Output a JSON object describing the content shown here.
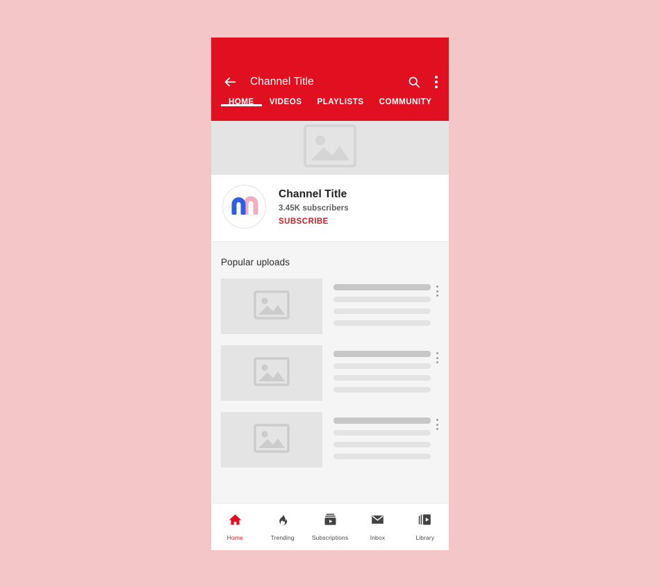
{
  "page": {
    "background_color": "#f4c6c8",
    "brand_red": "#e01020",
    "subscribe_red": "#cc2028"
  },
  "appbar": {
    "back_icon": "arrow-left-icon",
    "title": "Channel Title",
    "search_icon": "search-icon",
    "more_icon": "more-vertical-icon",
    "tabs": [
      {
        "label": "HOME",
        "active": true
      },
      {
        "label": "VIDEOS",
        "active": false
      },
      {
        "label": "PLAYLISTS",
        "active": false
      },
      {
        "label": "COMMUNITY",
        "active": false
      }
    ]
  },
  "banner": {
    "placeholder_icon": "image-placeholder-icon"
  },
  "channel": {
    "avatar_icon": "channel-avatar-logo",
    "name": "Channel Title",
    "subscribers": "3.45K subscribers",
    "subscribe_label": "SUBSCRIBE"
  },
  "content": {
    "section_title": "Popular uploads",
    "videos": [
      {
        "thumbnail_icon": "image-placeholder-icon",
        "more_icon": "more-vertical-icon"
      },
      {
        "thumbnail_icon": "image-placeholder-icon",
        "more_icon": "more-vertical-icon"
      },
      {
        "thumbnail_icon": "image-placeholder-icon",
        "more_icon": "more-vertical-icon"
      }
    ]
  },
  "bottom_nav": {
    "items": [
      {
        "label": "Home",
        "icon": "home-icon",
        "active": true
      },
      {
        "label": "Trending",
        "icon": "flame-icon",
        "active": false
      },
      {
        "label": "Subscriptions",
        "icon": "subscriptions-icon",
        "active": false
      },
      {
        "label": "Inbox",
        "icon": "envelope-icon",
        "active": false
      },
      {
        "label": "Library",
        "icon": "library-icon",
        "active": false
      }
    ]
  }
}
